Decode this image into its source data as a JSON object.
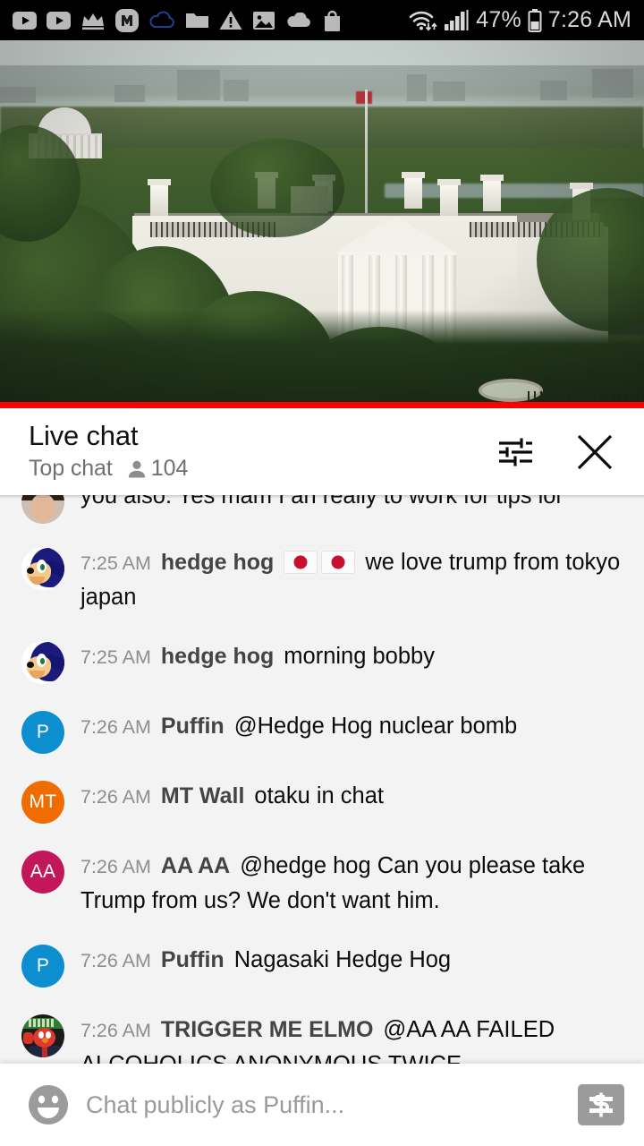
{
  "status_bar": {
    "icons": [
      {
        "name": "youtube-icon"
      },
      {
        "name": "youtube-icon"
      },
      {
        "name": "crown-icon"
      },
      {
        "name": "monster-app-icon"
      },
      {
        "name": "cloud-outline-icon"
      },
      {
        "name": "folder-icon"
      },
      {
        "name": "warning-triangle-icon"
      },
      {
        "name": "photo-icon"
      },
      {
        "name": "cloud-filled-icon"
      },
      {
        "name": "shopping-bag-icon"
      }
    ],
    "wifi_icon": "wifi-icon",
    "signal_icon": "cellular-signal-icon",
    "battery_percent": "47%",
    "battery_icon": "battery-icon",
    "time": "7:26 AM"
  },
  "video": {
    "name": "white-house-live-stream",
    "progress_percent": 100,
    "progress_color": "#ff0000"
  },
  "chat_header": {
    "title": "Live chat",
    "mode_label": "Top chat",
    "viewer_icon": "person-icon",
    "viewer_count": "104",
    "filter_icon": "tune-sliders-icon",
    "close_icon": "close-x-icon"
  },
  "messages": [
    {
      "id": "msg-partial",
      "partial": true,
      "avatar_type": "photo-crop",
      "avatar_initials": "",
      "avatar_color": "#cdbfb6",
      "timestamp": "",
      "author": "",
      "text": "you also. Yes mam I an really to work for tips lol",
      "emoji": ""
    },
    {
      "id": "msg-1",
      "partial": false,
      "avatar_type": "sonic",
      "avatar_initials": "",
      "avatar_color": "#ffffff",
      "timestamp": "7:25 AM",
      "author": "hedge hog",
      "emoji": "flags-japan-2",
      "text": "we love trump from tokyo japan"
    },
    {
      "id": "msg-2",
      "partial": false,
      "avatar_type": "sonic",
      "avatar_initials": "",
      "avatar_color": "#ffffff",
      "timestamp": "7:25 AM",
      "author": "hedge hog",
      "emoji": "",
      "text": "morning bobby"
    },
    {
      "id": "msg-3",
      "partial": false,
      "avatar_type": "initials",
      "avatar_initials": "P",
      "avatar_color": "#0d8ecf",
      "timestamp": "7:26 AM",
      "author": "Puffin",
      "emoji": "",
      "text": "@Hedge Hog nuclear bomb"
    },
    {
      "id": "msg-4",
      "partial": false,
      "avatar_type": "initials",
      "avatar_initials": "MT",
      "avatar_color": "#ef6c00",
      "timestamp": "7:26 AM",
      "author": "MT Wall",
      "emoji": "",
      "text": "otaku in chat"
    },
    {
      "id": "msg-5",
      "partial": false,
      "avatar_type": "initials",
      "avatar_initials": "AA",
      "avatar_color": "#c2185b",
      "timestamp": "7:26 AM",
      "author": "AA AA",
      "emoji": "",
      "text": "@hedge hog Can you please take Trump from us? We don't want him."
    },
    {
      "id": "msg-6",
      "partial": false,
      "avatar_type": "initials",
      "avatar_initials": "P",
      "avatar_color": "#0d8ecf",
      "timestamp": "7:26 AM",
      "author": "Puffin",
      "emoji": "",
      "text": "Nagasaki Hedge Hog"
    },
    {
      "id": "msg-7",
      "partial": false,
      "avatar_type": "elmo",
      "avatar_initials": "",
      "avatar_color": "#1b1b1b",
      "timestamp": "7:26 AM",
      "author": "TRIGGER ME ELMO",
      "emoji": "",
      "text": "@AA AA FAILED ALCOHOLICS ANONYMOUS TWICE ..."
    }
  ],
  "input_bar": {
    "emoji_icon": "smiley-face-icon",
    "placeholder": "Chat publicly as Puffin...",
    "superchat_icon": "dollar-bill-icon"
  },
  "colors": {
    "status_bar_bg": "#000000",
    "chat_bg": "#f3f3f3",
    "header_bg": "#ffffff",
    "accent_red": "#ff0000"
  }
}
